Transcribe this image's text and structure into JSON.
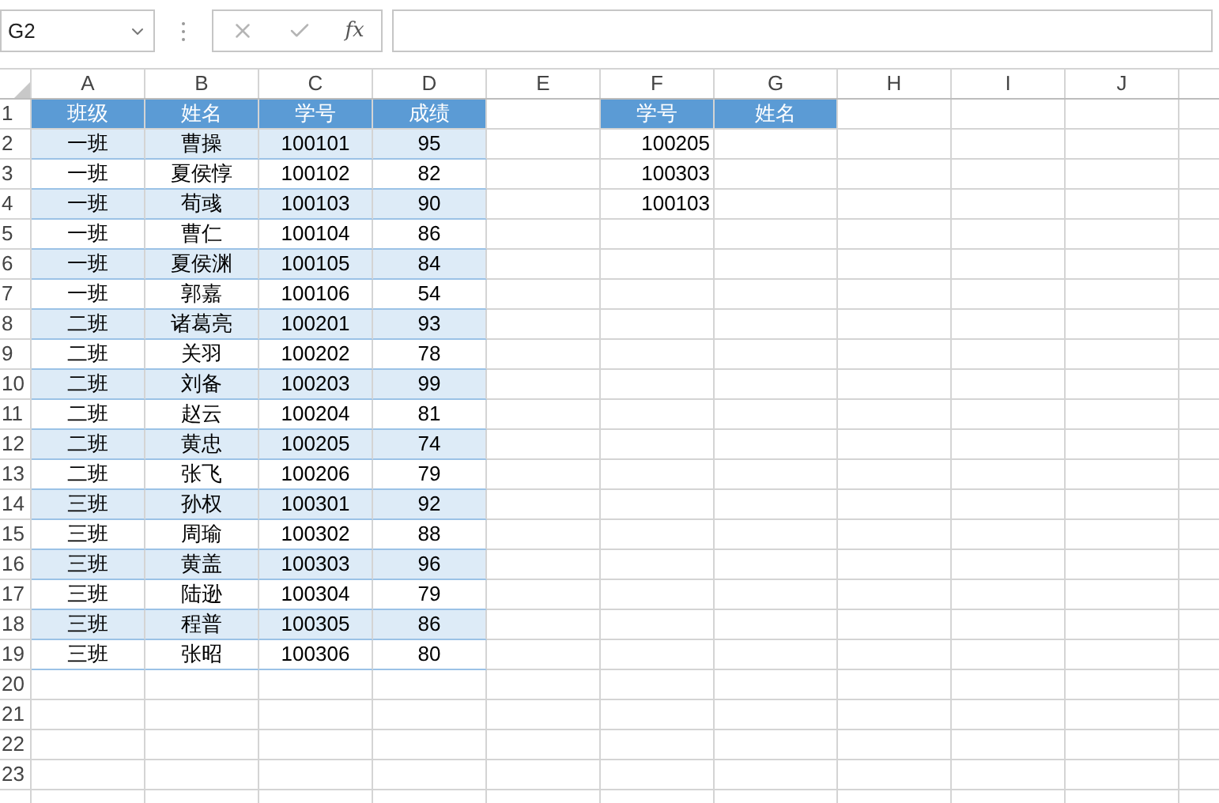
{
  "formula_bar": {
    "name_box": "G2",
    "fx": "fx"
  },
  "columns": [
    "A",
    "B",
    "C",
    "D",
    "E",
    "F",
    "G",
    "H",
    "I",
    "J"
  ],
  "row_numbers": [
    "1",
    "2",
    "3",
    "4",
    "5",
    "6",
    "7",
    "8",
    "9",
    "10",
    "11",
    "12",
    "13",
    "14",
    "15",
    "16",
    "17",
    "18",
    "19",
    "20",
    "21",
    "22",
    "23"
  ],
  "left_table": {
    "header": [
      "班级",
      "姓名",
      "学号",
      "成绩"
    ],
    "rows": [
      {
        "cells": [
          "一班",
          "曹操",
          "100101",
          "95"
        ],
        "shaded": true
      },
      {
        "cells": [
          "一班",
          "夏侯惇",
          "100102",
          "82"
        ],
        "shaded": false
      },
      {
        "cells": [
          "一班",
          "荀彧",
          "100103",
          "90"
        ],
        "shaded": true
      },
      {
        "cells": [
          "一班",
          "曹仁",
          "100104",
          "86"
        ],
        "shaded": false
      },
      {
        "cells": [
          "一班",
          "夏侯渊",
          "100105",
          "84"
        ],
        "shaded": true
      },
      {
        "cells": [
          "一班",
          "郭嘉",
          "100106",
          "54"
        ],
        "shaded": false
      },
      {
        "cells": [
          "二班",
          "诸葛亮",
          "100201",
          "93"
        ],
        "shaded": true
      },
      {
        "cells": [
          "二班",
          "关羽",
          "100202",
          "78"
        ],
        "shaded": false
      },
      {
        "cells": [
          "二班",
          "刘备",
          "100203",
          "99"
        ],
        "shaded": true
      },
      {
        "cells": [
          "二班",
          "赵云",
          "100204",
          "81"
        ],
        "shaded": false
      },
      {
        "cells": [
          "二班",
          "黄忠",
          "100205",
          "74"
        ],
        "shaded": true
      },
      {
        "cells": [
          "二班",
          "张飞",
          "100206",
          "79"
        ],
        "shaded": false
      },
      {
        "cells": [
          "三班",
          "孙权",
          "100301",
          "92"
        ],
        "shaded": true
      },
      {
        "cells": [
          "三班",
          "周瑜",
          "100302",
          "88"
        ],
        "shaded": false
      },
      {
        "cells": [
          "三班",
          "黄盖",
          "100303",
          "96"
        ],
        "shaded": true
      },
      {
        "cells": [
          "三班",
          "陆逊",
          "100304",
          "79"
        ],
        "shaded": false
      },
      {
        "cells": [
          "三班",
          "程普",
          "100305",
          "86"
        ],
        "shaded": true
      },
      {
        "cells": [
          "三班",
          "张昭",
          "100306",
          "80"
        ],
        "shaded": false
      }
    ]
  },
  "right_table": {
    "header": [
      "学号",
      "姓名"
    ],
    "rows": [
      {
        "cells": [
          "100205"
        ]
      },
      {
        "cells": [
          "100303"
        ]
      },
      {
        "cells": [
          "100103"
        ]
      }
    ]
  }
}
